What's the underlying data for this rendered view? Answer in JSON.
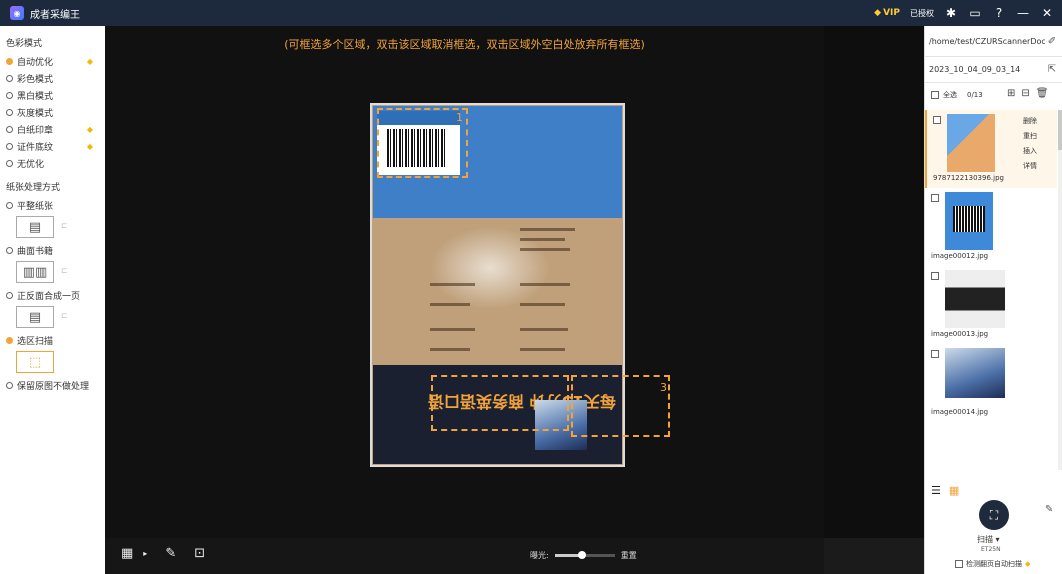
{
  "titlebar": {
    "app_title": "成者采编王",
    "vip_label": "VIP",
    "auth_label": "已授权",
    "icons": [
      "settings-icon",
      "message-icon",
      "help-icon",
      "minimize-icon",
      "close-icon"
    ]
  },
  "left_panel": {
    "color_mode_title": "色彩模式",
    "color_modes": [
      {
        "label": "自动优化",
        "selected": true,
        "premium": true
      },
      {
        "label": "彩色模式",
        "selected": false,
        "premium": false
      },
      {
        "label": "黑白模式",
        "selected": false,
        "premium": false
      },
      {
        "label": "灰度模式",
        "selected": false,
        "premium": false
      },
      {
        "label": "白纸印章",
        "selected": false,
        "premium": true
      },
      {
        "label": "证件底纹",
        "selected": false,
        "premium": true
      },
      {
        "label": "无优化",
        "selected": false,
        "premium": false
      }
    ],
    "paper_title": "纸张处理方式",
    "paper_modes": [
      {
        "label": "平整纸张",
        "selected": false
      },
      {
        "label": "曲面书籍",
        "selected": false
      },
      {
        "label": "正反面合成一页",
        "selected": false
      },
      {
        "label": "选区扫描",
        "selected": true
      },
      {
        "label": "保留原图不做处理",
        "selected": false
      }
    ]
  },
  "canvas": {
    "hint": "(可框选多个区域，双击该区域取消框选，双击区域外空白处放弃所有框选)",
    "selection_numbers": [
      "1",
      "3"
    ],
    "cover_text": "每天15分钟 商务英语口语"
  },
  "bottom_bar": {
    "exposure_label": "曝光:",
    "exposure_level": 0.45,
    "reset_label": "重置"
  },
  "right_panel": {
    "path": "/home/test/CZURScannerDoc/",
    "folder": "2023_10_04_09_03_14",
    "select_all_label": "全选",
    "count": "0/13",
    "item_menu": [
      "删除",
      "重扫",
      "插入",
      "详情"
    ],
    "items": [
      {
        "name": "9787122130396.jpg",
        "active": true
      },
      {
        "name": "image00012.jpg",
        "active": false
      },
      {
        "name": "image00013.jpg",
        "active": false
      },
      {
        "name": "image00014.jpg",
        "active": false
      }
    ],
    "scan_label": "扫描",
    "device": "ET25N",
    "autoscan_label": "检测翻页自动扫描"
  }
}
